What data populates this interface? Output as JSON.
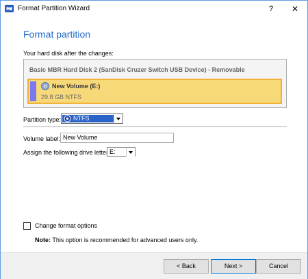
{
  "window": {
    "title": "Format Partition Wizard",
    "help": "?",
    "close": "✕"
  },
  "page": {
    "heading": "Format partition",
    "disk_caption": "Your hard disk after the changes:"
  },
  "disk": {
    "title": "Basic MBR Hard Disk 2 (SanDisk Cruzer Switch USB Device) - Removable",
    "partition": {
      "name": "New Volume (E:)",
      "size": "29.8 GB NTFS"
    }
  },
  "form": {
    "partition_type_label": "Partition type:",
    "partition_type_value": "NTFS",
    "volume_label_label": "Volume label:",
    "volume_label_value": "New Volume",
    "drive_letter_label": "Assign the following drive letter:",
    "drive_letter_value": "E:"
  },
  "options": {
    "change_format_label": "Change format options",
    "change_format_checked": false,
    "note_prefix": "Note:",
    "note_text": " This option is recommended for advanced users only."
  },
  "buttons": {
    "back": "< Back",
    "next": "Next >",
    "cancel": "Cancel"
  },
  "colors": {
    "accent": "#1f6ac9",
    "partition_fill": "#f8d97a",
    "partition_border": "#f0b23a",
    "selection": "#2a64c8"
  }
}
